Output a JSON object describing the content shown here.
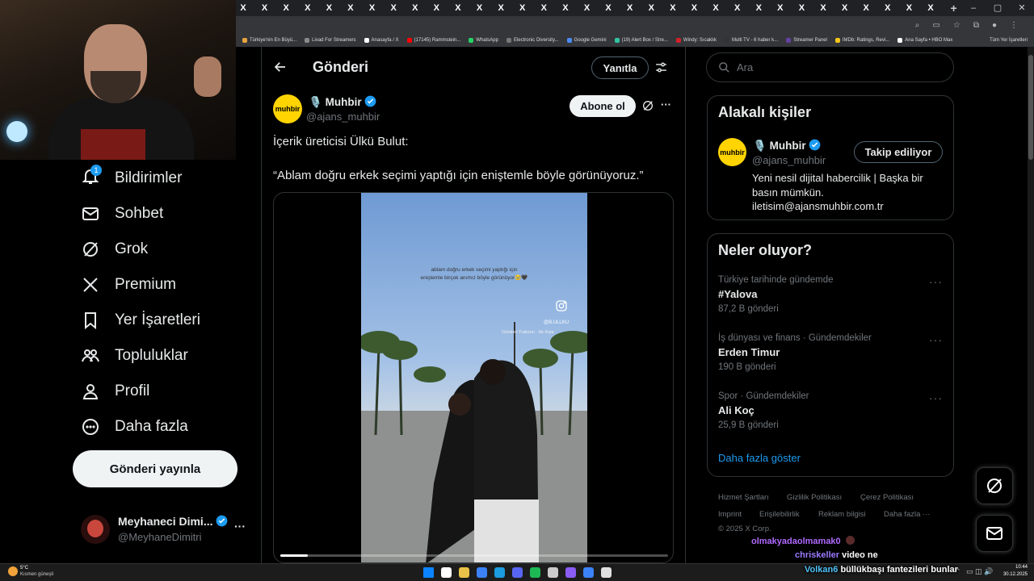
{
  "browser": {
    "tab_glyph": "X",
    "tab_count": 33,
    "new_tab": "+",
    "window_controls": [
      "–",
      "▢",
      "✕"
    ],
    "bookmarks": [
      {
        "label": "Türkiye'nin En Büyü...",
        "color": "#e8a33d"
      },
      {
        "label": "Livad For Streamers",
        "color": "#8a8a8a"
      },
      {
        "label": "Anasayfa / X",
        "color": "#ffffff"
      },
      {
        "label": "(17145) Rammstein...",
        "color": "#ff0000"
      },
      {
        "label": "WhatsApp",
        "color": "#25d366"
      },
      {
        "label": "Electronic Diversity...",
        "color": "#777777"
      },
      {
        "label": "Google Gemini",
        "color": "#4b8bf5"
      },
      {
        "label": "(19) Alert Box / Stre...",
        "color": "#31c3a2"
      },
      {
        "label": "Windy: Sıcaklık",
        "color": "#d3202a"
      },
      {
        "label": "Multi TV - 6 haber k...",
        "color": "#333333"
      },
      {
        "label": "Streamer Panel",
        "color": "#6441a5"
      },
      {
        "label": "IMDb: Ratings, Revi...",
        "color": "#f5c518"
      },
      {
        "label": "Ana Sayfa • HBO Max",
        "color": "#ffffff"
      }
    ],
    "all_bookmarks": "Tüm Yer İşaretleri"
  },
  "nav": {
    "notifications": {
      "label": "Bildirimler",
      "badge": "1"
    },
    "messages": "Sohbet",
    "grok": "Grok",
    "premium": "Premium",
    "bookmarks": "Yer İşaretleri",
    "communities": "Topluluklar",
    "profile": "Profil",
    "more": "Daha fazla",
    "post_button": "Gönderi yayınla",
    "account": {
      "name": "Meyhaneci Dimi...",
      "handle": "@MeyhaneDimitri",
      "more": "···"
    }
  },
  "header": {
    "title": "Gönderi",
    "reply_button": "Yanıtla"
  },
  "post": {
    "logo_text": "muhbir",
    "author_emoji": "🎙️",
    "author_name": "Muhbir",
    "handle": "@ajans_muhbir",
    "subscribe": "Abone ol",
    "more": "···",
    "line1": "İçerik üreticisi Ülkü Bulut:",
    "line2": "“Ablam doğru erkek seçimi yaptığı için eniştemle böyle görünüyoruz.”",
    "video": {
      "caption_1": "ablam doğru erkek seçimi yaptığı için",
      "caption_2": "eniştemle birçok anımız böyle görünüyor🥹🖤",
      "username": "@B.ULLKU",
      "location": "Gönderi Trabzon · Ak Kala",
      "progress": 0.07
    }
  },
  "search": {
    "placeholder": "Ara"
  },
  "related": {
    "title": "Alakalı kişiler",
    "emoji": "🎙️",
    "name": "Muhbir",
    "handle": "@ajans_muhbir",
    "follow_button": "Takip ediliyor",
    "bio_1": "Yeni nesil dijital habercilik | Başka bir",
    "bio_2": "basın mümkün.",
    "bio_3": "iletisim@ajansmuhbir.com.tr"
  },
  "trends": {
    "title": "Neler oluyor?",
    "items": [
      {
        "meta": "Türkiye tarihinde gündemde",
        "name": "#Yalova",
        "count": "87,2 B gönderi"
      },
      {
        "meta": "İş dünyası ve finans · Gündemdekiler",
        "name": "Erden Timur",
        "count": "190 B gönderi"
      },
      {
        "meta": "Spor · Gündemdekiler",
        "name": "Ali Koç",
        "count": "25,9 B gönderi"
      }
    ],
    "show_more": "Daha fazla göster"
  },
  "footer": {
    "links": [
      "Hizmet Şartları",
      "Gizlilik Politikası",
      "Çerez Politikası",
      "Imprint",
      "Erişilebilirlik",
      "Reklam bilgisi",
      "Daha fazla ···"
    ],
    "copyright": "© 2025 X Corp."
  },
  "chat": [
    {
      "user": "olmakyadaolmamak0",
      "text": "",
      "color": "#b069ff"
    },
    {
      "user": "chriskeller",
      "text": "video ne",
      "color": "#9b7bff"
    },
    {
      "user": "Volkan6",
      "text": "büllükbaşı fantezileri bunlar",
      "color": "#4fc3f7"
    }
  ],
  "taskbar": {
    "weather_temp": "5°C",
    "weather_text": "Kısmen güneşli",
    "time": "10:44",
    "date": "30.12.2025",
    "app_colors": [
      "#0a84ff",
      "#ffffff",
      "#e8c248",
      "#3b82f6",
      "#1b9be0",
      "#5865f2",
      "#1db954",
      "#cccccc",
      "#8b5cf6",
      "#3b82f6",
      "#e0e0e0"
    ]
  },
  "colors": {
    "accent": "#1d9bf0",
    "muhbir_yellow": "#ffd400"
  }
}
